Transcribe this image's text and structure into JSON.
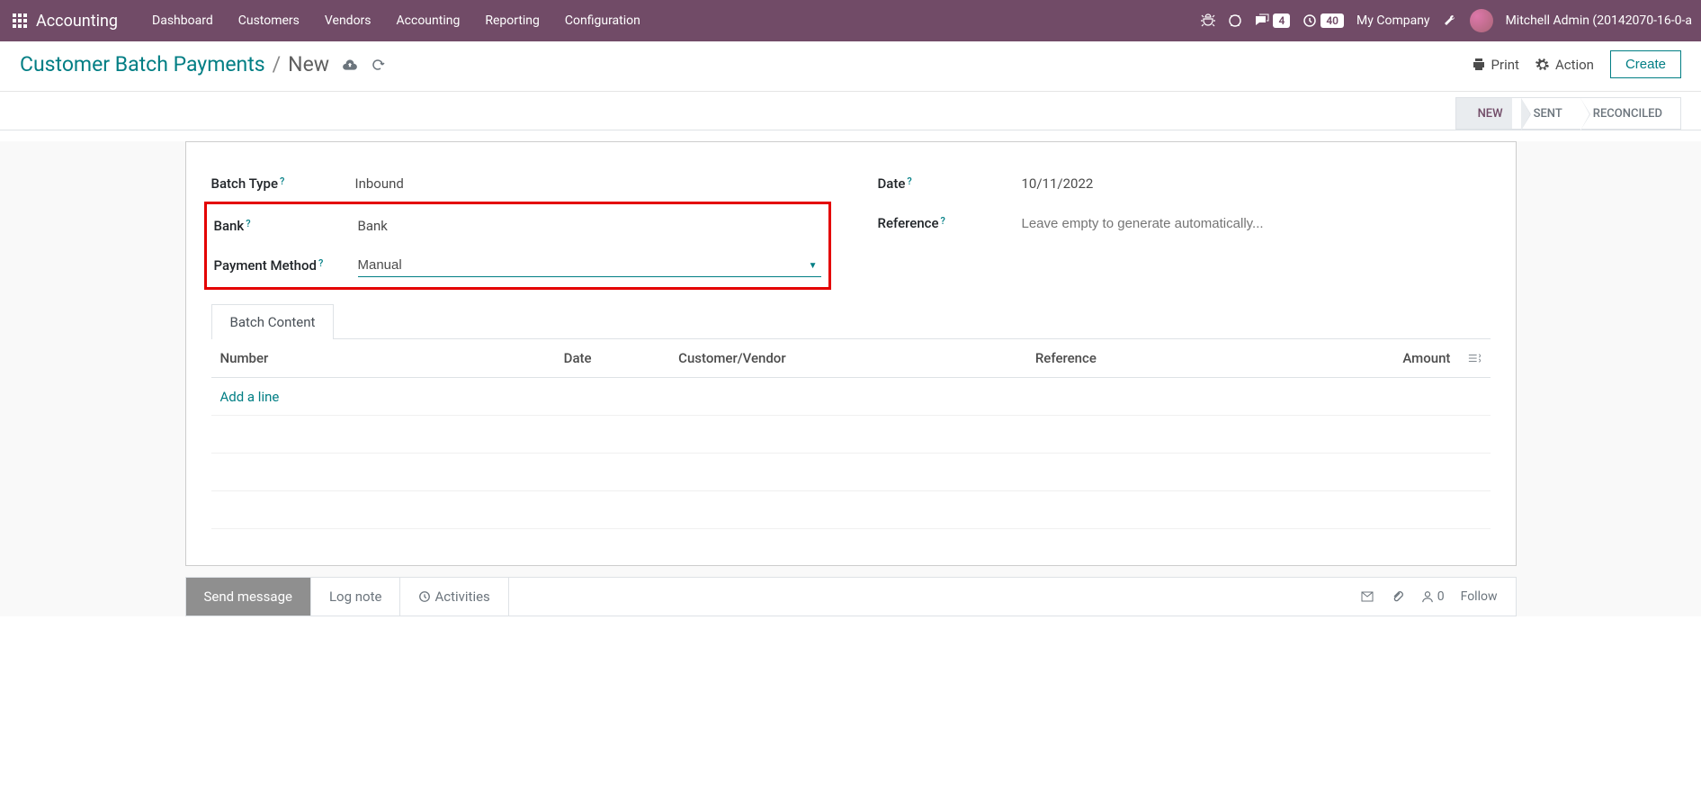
{
  "nav": {
    "app_name": "Accounting",
    "menu": [
      "Dashboard",
      "Customers",
      "Vendors",
      "Accounting",
      "Reporting",
      "Configuration"
    ],
    "messages_badge": "4",
    "activities_badge": "40",
    "company": "My Company",
    "user": "Mitchell Admin (20142070-16-0-a"
  },
  "breadcrumb": {
    "parent": "Customer Batch Payments",
    "current": "New"
  },
  "actions": {
    "print": "Print",
    "action": "Action",
    "create": "Create"
  },
  "status": {
    "s1": "NEW",
    "s2": "SENT",
    "s3": "RECONCILED"
  },
  "form": {
    "batch_type_label": "Batch Type",
    "batch_type_value": "Inbound",
    "bank_label": "Bank",
    "bank_value": "Bank",
    "payment_method_label": "Payment Method",
    "payment_method_value": "Manual",
    "date_label": "Date",
    "date_value": "10/11/2022",
    "reference_label": "Reference",
    "reference_placeholder": "Leave empty to generate automatically..."
  },
  "tabs": {
    "batch_content": "Batch Content"
  },
  "table": {
    "cols": {
      "number": "Number",
      "date": "Date",
      "customer": "Customer/Vendor",
      "reference": "Reference",
      "amount": "Amount"
    },
    "add_line": "Add a line"
  },
  "chatter": {
    "send": "Send message",
    "log": "Log note",
    "activities": "Activities",
    "follow": "Follow",
    "followers": "0"
  }
}
